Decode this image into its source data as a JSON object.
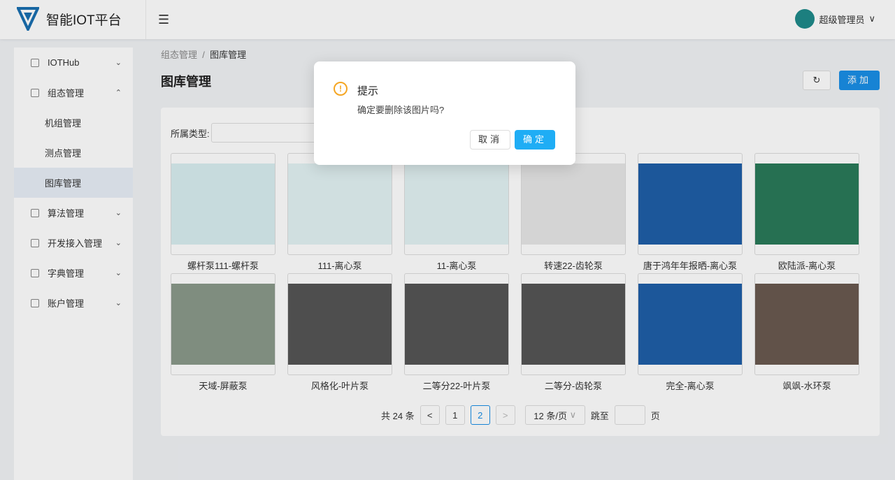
{
  "app": {
    "title": "智能IOT平台",
    "user": "超级管理员"
  },
  "sidebar": {
    "items": [
      {
        "label": "IOTHub",
        "chev": "⌄"
      },
      {
        "label": "组态管理",
        "chev": "⌃"
      },
      {
        "label": "机组管理",
        "sub": true
      },
      {
        "label": "测点管理",
        "sub": true
      },
      {
        "label": "图库管理",
        "sub": true,
        "active": true
      },
      {
        "label": "算法管理",
        "chev": "⌄"
      },
      {
        "label": "开发接入管理",
        "chev": "⌄"
      },
      {
        "label": "字典管理",
        "chev": "⌄"
      },
      {
        "label": "账户管理",
        "chev": "⌄"
      }
    ]
  },
  "breadcrumb": {
    "parent": "组态管理",
    "sep": "/",
    "current": "图库管理"
  },
  "page": {
    "title": "图库管理",
    "refresh": "↻",
    "add": "添加",
    "filter_label": "所属类型:"
  },
  "gallery": [
    {
      "name": "螺杆泵111-螺杆泵",
      "color": "#d8eef0"
    },
    {
      "name": "111-离心泵",
      "color": "#e2f2f4"
    },
    {
      "name": "11-离心泵",
      "color": "#e2f2f4"
    },
    {
      "name": "转速22-齿轮泵",
      "color": "#e6e6e6"
    },
    {
      "name": "唐于鸿年年报晒-离心泵",
      "color": "#1f5fa8"
    },
    {
      "name": "欧陆派-离心泵",
      "color": "#2a7a5a"
    },
    {
      "name": "天域-屏蔽泵",
      "color": "#8a9a8a"
    },
    {
      "name": "风格化-叶片泵",
      "color": "#555555"
    },
    {
      "name": "二等分22-叶片泵",
      "color": "#555555"
    },
    {
      "name": "二等分-齿轮泵",
      "color": "#555555"
    },
    {
      "name": "完全-离心泵",
      "color": "#1f5fa8"
    },
    {
      "name": "飒飒-水环泵",
      "color": "#6a5a50"
    }
  ],
  "pagination": {
    "total": "共 24 条",
    "prev": "<",
    "pages": [
      "1",
      "2"
    ],
    "current": "2",
    "next": ">",
    "size": "12 条/页",
    "jump": "跳至",
    "page_unit": "页"
  },
  "dialog": {
    "title": "提示",
    "message": "确定要删除该图片吗?",
    "cancel": "取消",
    "ok": "确定",
    "icon": "!"
  }
}
